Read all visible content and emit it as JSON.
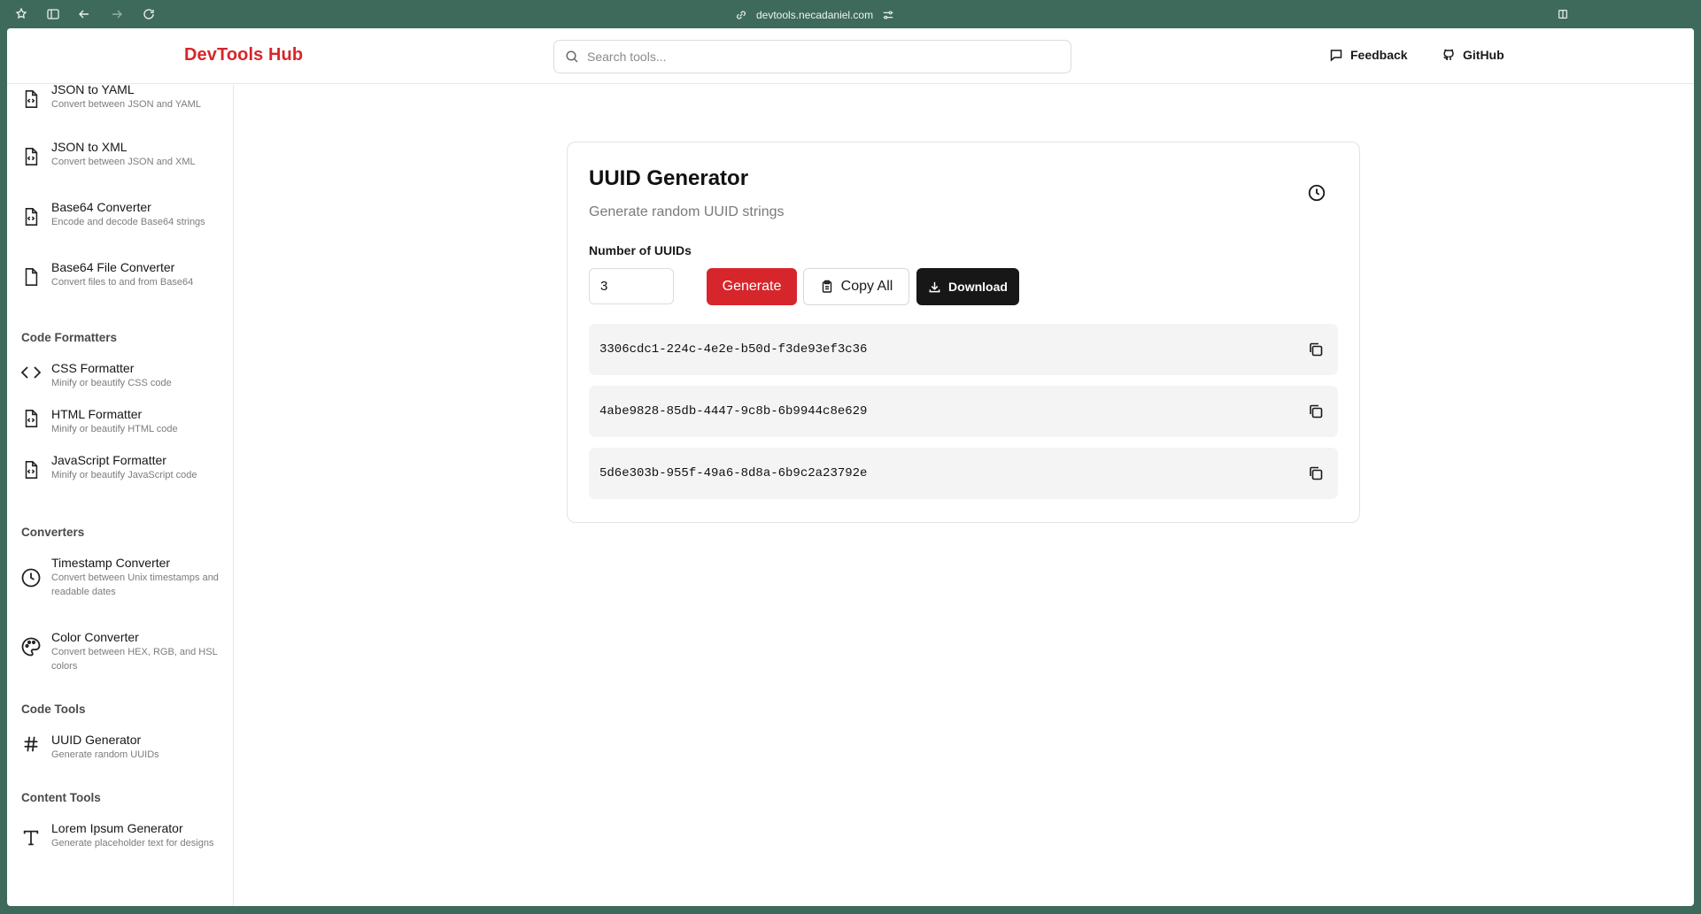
{
  "browser": {
    "url": "devtools.necadaniel.com"
  },
  "header": {
    "brand": "DevTools Hub",
    "search_placeholder": "Search tools...",
    "feedback_label": "Feedback",
    "github_label": "GitHub"
  },
  "sidebar": {
    "items": [
      {
        "title": "JSON to YAML",
        "desc": "Convert between JSON and YAML",
        "icon": "file-code-icon"
      },
      {
        "title": "JSON to XML",
        "desc": "Convert between JSON and XML",
        "icon": "file-code-icon"
      },
      {
        "title": "Base64 Converter",
        "desc": "Encode and decode Base64 strings",
        "icon": "file-code-icon"
      },
      {
        "title": "Base64 File Converter",
        "desc": "Convert files to and from Base64",
        "icon": "file-icon"
      },
      {
        "title": "CSS Formatter",
        "desc": "Minify or beautify CSS code",
        "icon": "code-icon"
      },
      {
        "title": "HTML Formatter",
        "desc": "Minify or beautify HTML code",
        "icon": "file-code-icon"
      },
      {
        "title": "JavaScript Formatter",
        "desc": "Minify or beautify JavaScript code",
        "icon": "file-code-icon"
      },
      {
        "title": "Timestamp Converter",
        "desc": "Convert between Unix timestamps and readable dates",
        "icon": "clock-icon"
      },
      {
        "title": "Color Converter",
        "desc": "Convert between HEX, RGB, and HSL colors",
        "icon": "palette-icon"
      },
      {
        "title": "UUID Generator",
        "desc": "Generate random UUIDs",
        "icon": "hash-icon"
      },
      {
        "title": "Lorem Ipsum Generator",
        "desc": "Generate placeholder text for designs",
        "icon": "type-icon"
      }
    ],
    "sections": {
      "code_formatters": "Code Formatters",
      "converters": "Converters",
      "code_tools": "Code Tools",
      "content_tools": "Content Tools"
    }
  },
  "tool": {
    "title": "UUID Generator",
    "subtitle": "Generate random UUID strings",
    "count_label": "Number of UUIDs",
    "count_value": "3",
    "generate_label": "Generate",
    "copy_all_label": "Copy All",
    "download_label": "Download",
    "uuids": [
      "3306cdc1-224c-4e2e-b50d-f3de93ef3c36",
      "4abe9828-85db-4447-9c8b-6b9944c8e629",
      "5d6e303b-955f-49a6-8d8a-6b9c2a23792e"
    ]
  },
  "colors": {
    "brand": "#d6262b",
    "dark_button": "#171717",
    "frame": "#3e6a5c"
  }
}
